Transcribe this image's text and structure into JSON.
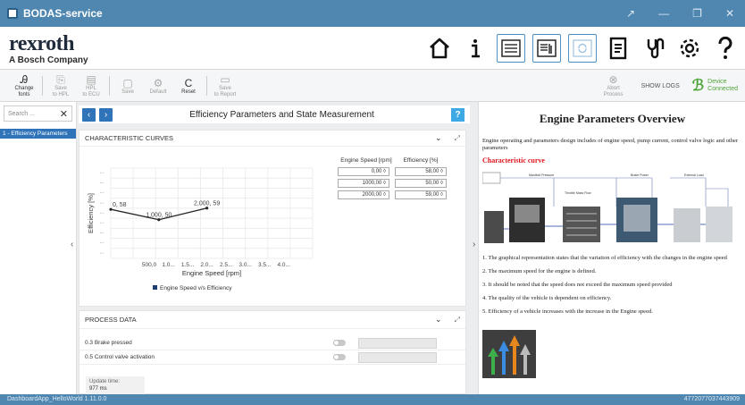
{
  "window": {
    "title": "BODAS-service",
    "controls": [
      "↗",
      "—",
      "❐",
      "✕"
    ]
  },
  "brand": {
    "name": "rexroth",
    "subtitle": "A Bosch Company"
  },
  "nav_icons": [
    "home-icon",
    "info-icon",
    "list-icon",
    "dashboard-icon",
    "refresh-icon",
    "document-icon",
    "plug-icon",
    "gear-icon",
    "help-icon"
  ],
  "toolbar": {
    "buttons": [
      {
        "label1": "Change",
        "label2": "fonts",
        "icon": "Ꭿ"
      },
      {
        "label1": "Save",
        "label2": "to HPL",
        "icon": "⎘"
      },
      {
        "label1": "HPL",
        "label2": "to ECU",
        "icon": "▤"
      },
      {
        "label1": "Save",
        "label2": "",
        "icon": "▢"
      },
      {
        "label1": "Default",
        "label2": "",
        "icon": "⚙"
      },
      {
        "label1": "Reset",
        "label2": "",
        "icon": "C"
      },
      {
        "label1": "Save",
        "label2": "to Report",
        "icon": "▭"
      }
    ],
    "abort_label1": "Abort",
    "abort_label2": "Process",
    "show_logs": "SHOW LOGS",
    "device_label1": "Device",
    "device_label2": "Connected"
  },
  "sidebar": {
    "search_placeholder": "Search ...",
    "items": [
      "1 - Efficiency Parameters"
    ]
  },
  "page": {
    "title": "Efficiency Parameters and State Measurement"
  },
  "curves_panel": {
    "title": "CHARACTERISTIC CURVES"
  },
  "efficiency_table": {
    "headers": [
      "Engine Speed [rpm]",
      "Efficiency [%]"
    ],
    "rows": [
      [
        "0,00 ◊",
        "58,00 ◊"
      ],
      [
        "1000,00 ◊",
        "50,00 ◊"
      ],
      [
        "2000,00 ◊",
        "59,00 ◊"
      ]
    ]
  },
  "chart_data": {
    "type": "line",
    "xlabel": "Engine Speed [rpm]",
    "ylabel": "Efficiency [%]",
    "x_tick_labels": [
      "500,0",
      "1.0...",
      "1.5...",
      "2.0...",
      "2.5...",
      "3.0...",
      "3.5...",
      "4.0..."
    ],
    "y_tick_labels": [
      "...",
      "...",
      "...",
      "...",
      "...",
      "...",
      "...",
      "...",
      "..."
    ],
    "series": [
      {
        "name": "Engine Speed v/s Efficiency",
        "x": [
          0,
          1000,
          2000
        ],
        "y": [
          58,
          50,
          59
        ]
      }
    ],
    "point_labels": [
      "0, 58",
      "1,000, 50",
      "2,000, 59"
    ],
    "xlim": [
      0,
      4200
    ],
    "ylim": [
      20,
      90
    ],
    "legend": "bottom",
    "line_color": "#222222",
    "legend_color": "#1f3f73",
    "grid": true
  },
  "process_panel": {
    "title": "PROCESS DATA",
    "rows": [
      "0.3 Brake pressed",
      "0.5 Control valve activation"
    ],
    "update_label": "Update time:",
    "update_value": "977 ms"
  },
  "right_panel": {
    "title": "Engine Parameters Overview",
    "intro": "Engine operating and parameters design includes of engine speed, pump current, control valve logic and other parameters",
    "curve_heading": "Characteristic curve",
    "points": [
      "1. The graphical representation states that the variation of efficiency with the changes in the engine speed",
      "2. The maximum speed for the engine is defined.",
      "3. It should be noted that the speed does not exceed the maximum speed provided",
      "4. The quality of the vehicle is dependent on efficiency.",
      "5. Efficiency of a vehicle increases with the increase in the Engine speed."
    ],
    "diagram_labels": [
      "Manifold Pressure",
      "Brake Power",
      "External Load",
      "Throttle Mass Flow"
    ]
  },
  "status": {
    "left": "DashboardApp_HelloWorld 1.11.0.0",
    "right": "4772077037443909"
  },
  "colors": {
    "titlebar": "#4f87b1",
    "accent": "#2f74b8",
    "connected": "#4ea43a",
    "heading_red": "#e0141e"
  }
}
